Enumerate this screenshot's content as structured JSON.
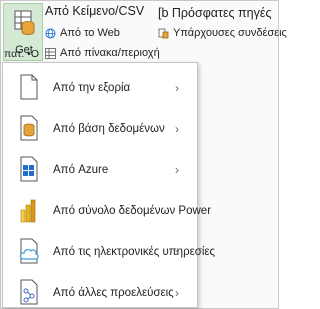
{
  "ribbon": {
    "get_label": "Get",
    "cmd_from_text": "Από Κείμενο/CSV",
    "cmd_recent": "[b Πρόσφατες πηγές",
    "cmd_from_web": "Από το Web",
    "cmd_existing": "Υπάρχουσες συνδέσεις",
    "cmd_from_table": "Από πίνακα/περιοχή",
    "mini_label": "πατ. •O"
  },
  "menu": {
    "items": [
      {
        "label": "Από την εξορία",
        "icon": "file-icon",
        "submenu": true
      },
      {
        "label": "Από βάση δεδομένων",
        "icon": "database-icon",
        "submenu": true
      },
      {
        "label": "Από Azure",
        "icon": "windows-icon",
        "submenu": true
      },
      {
        "label": "Από σύνολο δεδομένων Power",
        "icon": "powerbi-icon",
        "submenu": false
      },
      {
        "label": "Από τις ηλεκτρονικές υπηρεσίες",
        "icon": "cloud-icon",
        "submenu": true
      },
      {
        "label": "Από άλλες προελεύσεις",
        "icon": "other-sources-icon",
        "submenu": true
      }
    ],
    "chevron": "›"
  },
  "colors": {
    "get_bg": "#d3e9d3",
    "db_orange": "#e8a33b",
    "windows_blue": "#1e6fd0",
    "powerbi_yellow": "#e8b21b",
    "cloud_blue": "#3b9fd6"
  }
}
